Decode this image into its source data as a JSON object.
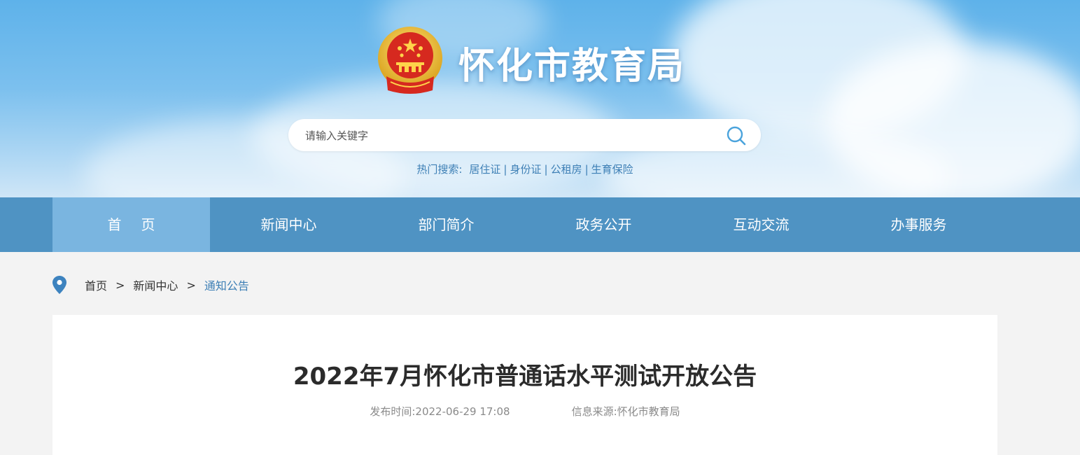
{
  "header": {
    "site_title": "怀化市教育局",
    "search_placeholder": "请输入关键字",
    "hot_label": "热门搜索:",
    "hot_items": [
      "居住证",
      "身份证",
      "公租房",
      "生育保险"
    ]
  },
  "nav": {
    "items": [
      "首页",
      "新闻中心",
      "部门简介",
      "政务公开",
      "互动交流",
      "办事服务"
    ],
    "active_index": 0
  },
  "breadcrumb": [
    "首页",
    "新闻中心",
    "通知公告"
  ],
  "article": {
    "title": "2022年7月怀化市普通话水平测试开放公告",
    "publish_label": "发布时间:",
    "publish_time": "2022-06-29 17:08",
    "source_label": "信息来源:",
    "source": "怀化市教育局"
  },
  "colors": {
    "nav_bg": "#4f93c3",
    "nav_active": "#7ab5e0",
    "accent_text": "#3d7fb5"
  }
}
